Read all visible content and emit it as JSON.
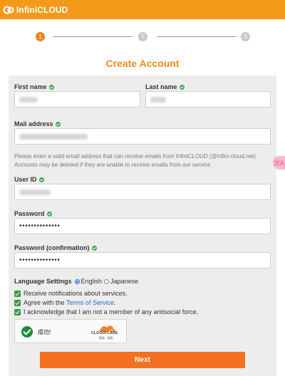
{
  "brand": {
    "name": "InfiniCLOUD",
    "color": "#f39a1a"
  },
  "stepper": {
    "steps": [
      "1",
      "2",
      "3"
    ],
    "active_step": 1
  },
  "page_title": "Create Account",
  "form": {
    "first_name": {
      "label": "First name"
    },
    "last_name": {
      "label": "Last name"
    },
    "mail": {
      "label": "Mail address"
    },
    "mail_hint": "Please enter a valid email address that can receive emails from InfiniCLOUD (@infini-cloud.net). Accounts may be deleted if they are unable to receive emails from our service.",
    "user_id": {
      "label": "User ID"
    },
    "password": {
      "label": "Password",
      "value": "••••••••••••••"
    },
    "password_confirm": {
      "label": "Password (confirmation)",
      "value": "••••••••••••••"
    },
    "language": {
      "label": "Language Settings",
      "options": [
        "English",
        "Japanese"
      ],
      "selected": "English"
    },
    "checks": {
      "notifications": "Receive notifications about services.",
      "terms_prefix": "Agree with the ",
      "terms_link": "Terms of Service",
      "terms_suffix": ".",
      "antisocial": "I acknowledge that I am not a member of any antisocial force."
    },
    "captcha": {
      "status": "成功!",
      "provider": "CLOUDFLARE",
      "links": "隐私 · 条款"
    },
    "next_label": "Next"
  },
  "side_tab": {
    "label": "文A"
  },
  "colors": {
    "accent": "#f37021",
    "title": "#f08a1e",
    "check": "#33a852",
    "link": "#1a6fd1"
  }
}
